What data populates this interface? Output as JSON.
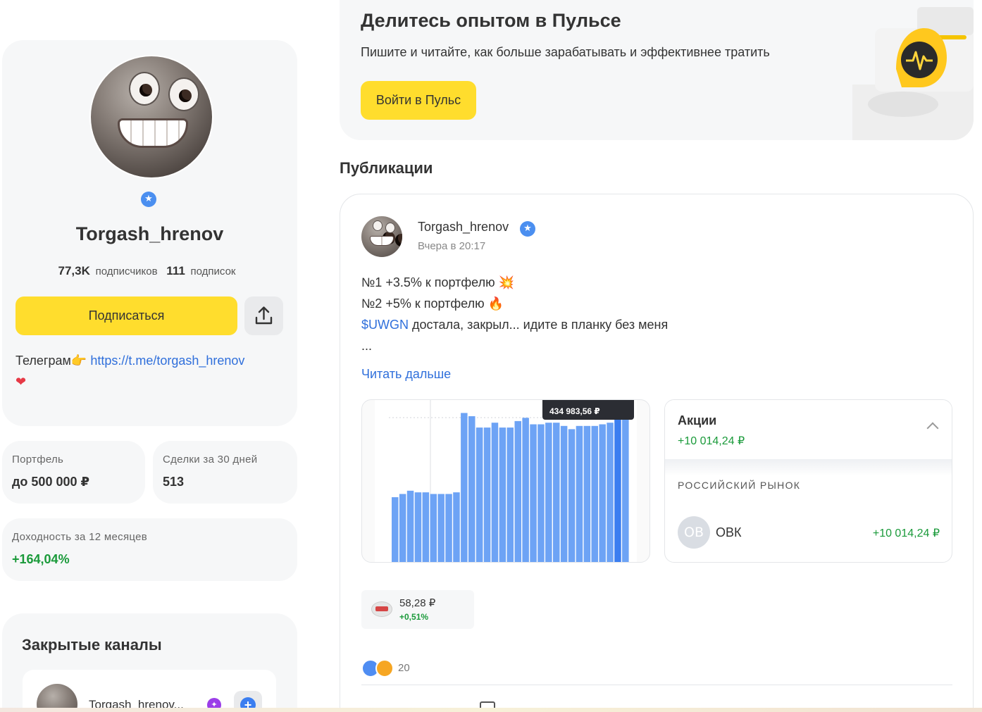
{
  "profile": {
    "name": "Torgash_hrenov",
    "subscribers_count": "77,3K",
    "subscribers_label": "подписчиков",
    "subscriptions_count": "111",
    "subscriptions_label": "подписок",
    "subscribe_label": "Подписаться",
    "bio_prefix": "Телеграм",
    "bio_link": "https://t.me/torgash_hrenov",
    "bio_pointing_emoji": "👉",
    "bio_heart_emoji": "❤"
  },
  "stats": {
    "portfolio_label": "Портфель",
    "portfolio_value": "до 500 000 ₽",
    "deals_label": "Сделки за 30 дней",
    "deals_value": "513",
    "yield_label": "Доходность за 12 месяцев",
    "yield_value": "+164,04%"
  },
  "closed_channels": {
    "title": "Закрытые каналы",
    "item_name": "Torgash_hrenov..."
  },
  "promo": {
    "title": "Делитесь опытом в Пульсе",
    "subtitle": "Пишите и читайте, как больше зарабатывать и эффективнее тратить",
    "button_label": "Войти в Пульс"
  },
  "publications": {
    "title": "Публикации"
  },
  "post": {
    "author": "Torgash_hrenov",
    "time": "Вчера в 20:17",
    "line1": "№1 +3.5% к портфелю",
    "line1_emoji": "💥",
    "line2": "№2 +5% к портфелю",
    "line2_emoji": "🔥",
    "line3_ticker": "$UWGN",
    "line3_rest": " достала, закрыл... идите в планку без меня",
    "line4": "...",
    "read_more": "Читать дальше",
    "reactions_count": "20"
  },
  "chart_data": {
    "type": "bar",
    "tooltip_value": "434 983,56 ₽",
    "values": [
      0.4,
      0.42,
      0.44,
      0.43,
      0.43,
      0.42,
      0.42,
      0.42,
      0.43,
      0.92,
      0.9,
      0.83,
      0.83,
      0.86,
      0.83,
      0.83,
      0.87,
      0.89,
      0.85,
      0.85,
      0.86,
      0.86,
      0.84,
      0.82,
      0.84,
      0.84,
      0.84,
      0.85,
      0.86,
      0.88,
      0.92
    ]
  },
  "holdings": {
    "title": "Акции",
    "total_change": "+10 014,24 ₽",
    "market_label": "РОССИЙСКИЙ РЫНОК",
    "ticker_logo_text": "OB",
    "ticker_name": "ОВК",
    "ticker_change": "+10 014,24 ₽"
  },
  "quote": {
    "price": "58,28 ₽",
    "change": "+0,51%"
  },
  "colors": {
    "accent_yellow": "#ffdd2d",
    "link_blue": "#2f6fdb",
    "positive_green": "#1a9a3a",
    "bar_blue": "#6da3f5",
    "bar_highlight": "#3b7ef0"
  }
}
